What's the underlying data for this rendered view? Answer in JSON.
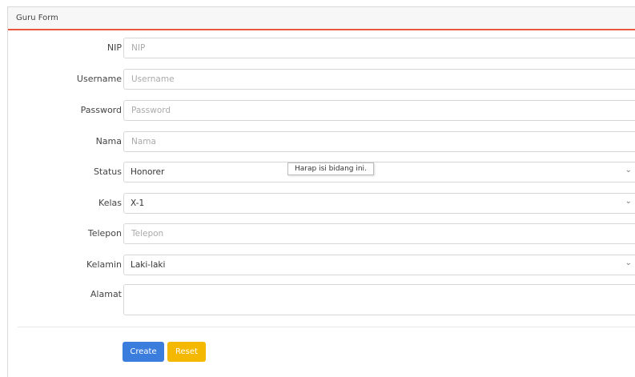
{
  "card": {
    "title": "Guru Form"
  },
  "fields": {
    "nip": {
      "label": "NIP",
      "placeholder": "NIP"
    },
    "username": {
      "label": "Username",
      "placeholder": "Username"
    },
    "password": {
      "label": "Password",
      "placeholder": "Password"
    },
    "nama": {
      "label": "Nama",
      "placeholder": "Nama"
    },
    "status": {
      "label": "Status",
      "value": "Honorer"
    },
    "kelas": {
      "label": "Kelas",
      "value": "X-1"
    },
    "telepon": {
      "label": "Telepon",
      "placeholder": "Telepon"
    },
    "kelamin": {
      "label": "Kelamin",
      "value": "Laki-laki"
    },
    "alamat": {
      "label": "Alamat",
      "value": ""
    }
  },
  "tooltip": {
    "text": "Harap isi bidang ini."
  },
  "buttons": {
    "create": "Create",
    "reset": "Reset"
  },
  "colors": {
    "header_accent": "#e9573f",
    "create_button": "#3b7ddd",
    "reset_button": "#f5b800"
  },
  "icons": {
    "select_chevron": "chevron-down-icon",
    "textarea_resize": "resize-handle-icon"
  }
}
